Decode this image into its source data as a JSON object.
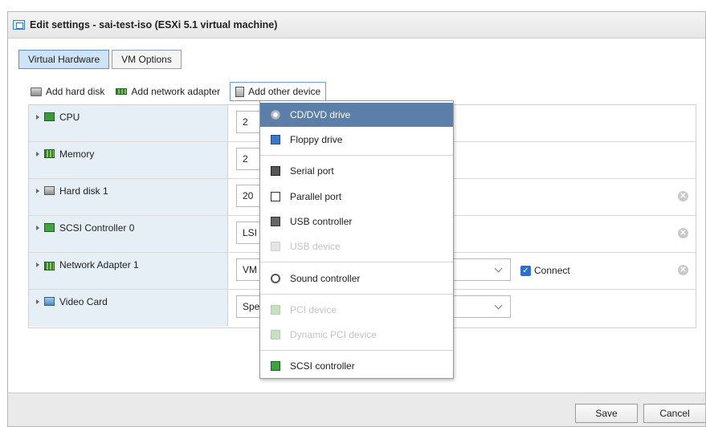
{
  "window": {
    "title": "Edit settings - sai-test-iso (ESXi 5.1 virtual machine)"
  },
  "tabs": [
    {
      "label": "Virtual Hardware",
      "active": true
    },
    {
      "label": "VM Options",
      "active": false
    }
  ],
  "toolbar": {
    "add_hard_disk": "Add hard disk",
    "add_network_adapter": "Add network adapter",
    "add_other_device": "Add other device"
  },
  "hardware": {
    "cpu": {
      "label": "CPU",
      "value": "2"
    },
    "memory": {
      "label": "Memory",
      "value": "2"
    },
    "hard_disk": {
      "label": "Hard disk 1",
      "value": "20"
    },
    "scsi": {
      "label": "SCSI Controller 0",
      "value": "LSI"
    },
    "network": {
      "label": "Network Adapter 1",
      "value": "VM",
      "connect_label": "Connect",
      "connected": true
    },
    "video": {
      "label": "Video Card",
      "value": "Spe"
    }
  },
  "device_menu": {
    "items": [
      {
        "label": "CD/DVD drive",
        "selected": true,
        "disabled": false,
        "icon": "cd-dvd-icon"
      },
      {
        "label": "Floppy drive",
        "selected": false,
        "disabled": false,
        "icon": "floppy-icon"
      },
      {
        "label": "Serial port",
        "selected": false,
        "disabled": false,
        "icon": "serial-port-icon"
      },
      {
        "label": "Parallel port",
        "selected": false,
        "disabled": false,
        "icon": "parallel-port-icon"
      },
      {
        "label": "USB controller",
        "selected": false,
        "disabled": false,
        "icon": "usb-controller-icon"
      },
      {
        "label": "USB device",
        "selected": false,
        "disabled": true,
        "icon": "usb-device-icon"
      },
      {
        "label": "Sound controller",
        "selected": false,
        "disabled": false,
        "icon": "sound-icon"
      },
      {
        "label": "PCI device",
        "selected": false,
        "disabled": true,
        "icon": "pci-icon"
      },
      {
        "label": "Dynamic PCI device",
        "selected": false,
        "disabled": true,
        "icon": "pci-icon"
      },
      {
        "label": "SCSI controller",
        "selected": false,
        "disabled": false,
        "icon": "scsi-icon"
      }
    ]
  },
  "footer": {
    "save": "Save",
    "cancel": "Cancel"
  },
  "colors": {
    "accent": "#5b7fa8",
    "label_column": "#e6eef6",
    "checkbox": "#2a6fd1"
  }
}
